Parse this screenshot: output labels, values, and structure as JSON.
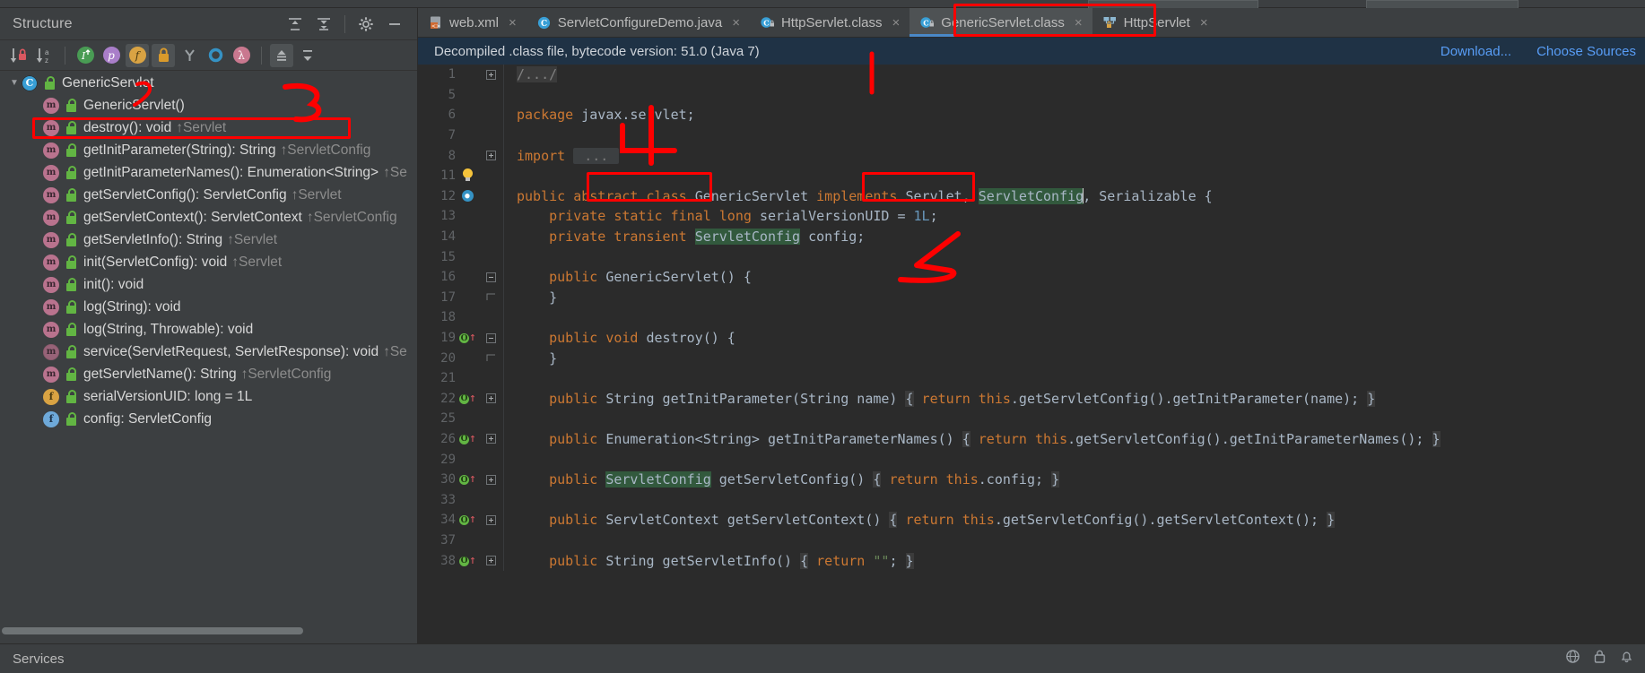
{
  "structure": {
    "title": "Structure",
    "header_actions": [
      {
        "name": "expand-all-icon",
        "glyph": "expand"
      },
      {
        "name": "collapse-all-icon",
        "glyph": "collapse"
      },
      {
        "name": "settings-gear-icon",
        "glyph": "gear"
      },
      {
        "name": "hide-icon",
        "glyph": "minus"
      }
    ],
    "toolbar": [
      {
        "name": "sort-by-visibility-button",
        "label": "sort-visibility"
      },
      {
        "name": "sort-alphabetically-button",
        "label": "sort-alpha"
      },
      {
        "name": "show-inherited-button",
        "label": "i"
      },
      {
        "name": "show-properties-button",
        "label": "p"
      },
      {
        "name": "show-fields-button",
        "label": "f"
      },
      {
        "name": "show-non-public-button",
        "label": "lock"
      },
      {
        "name": "show-anonymous-classes-button",
        "label": "Y"
      },
      {
        "name": "show-interfaces-button",
        "label": "O"
      },
      {
        "name": "show-lambdas-button",
        "label": "λ"
      },
      {
        "name": "scroll-from-source-button",
        "label": "up"
      },
      {
        "name": "scroll-to-source-button",
        "label": "down"
      }
    ],
    "tree": [
      {
        "icon": "class-icon",
        "visibility": "public",
        "label": "GenericServlet",
        "owner": "",
        "depth": 0,
        "expanded": true,
        "abstract": false,
        "kind": "class"
      },
      {
        "icon": "method-icon",
        "visibility": "public",
        "label": "GenericServlet()",
        "owner": "",
        "depth": 1,
        "abstract": false,
        "kind": "method"
      },
      {
        "icon": "method-icon",
        "visibility": "public",
        "label": "destroy(): void",
        "owner": "↑Servlet",
        "depth": 1,
        "abstract": false,
        "kind": "method"
      },
      {
        "icon": "method-icon",
        "visibility": "public",
        "label": "getInitParameter(String): String",
        "owner": "↑ServletConfig",
        "depth": 1,
        "abstract": false,
        "kind": "method",
        "highlighted": true
      },
      {
        "icon": "method-icon",
        "visibility": "public",
        "label": "getInitParameterNames(): Enumeration<String>",
        "owner": "↑Se",
        "depth": 1,
        "abstract": false,
        "kind": "method"
      },
      {
        "icon": "method-icon",
        "visibility": "public",
        "label": "getServletConfig(): ServletConfig",
        "owner": "↑Servlet",
        "depth": 1,
        "abstract": false,
        "kind": "method"
      },
      {
        "icon": "method-icon",
        "visibility": "public",
        "label": "getServletContext(): ServletContext",
        "owner": "↑ServletConfig",
        "depth": 1,
        "abstract": false,
        "kind": "method"
      },
      {
        "icon": "method-icon",
        "visibility": "public",
        "label": "getServletInfo(): String",
        "owner": "↑Servlet",
        "depth": 1,
        "abstract": false,
        "kind": "method"
      },
      {
        "icon": "method-icon",
        "visibility": "public",
        "label": "init(ServletConfig): void",
        "owner": "↑Servlet",
        "depth": 1,
        "abstract": false,
        "kind": "method"
      },
      {
        "icon": "method-icon",
        "visibility": "public",
        "label": "init(): void",
        "owner": "",
        "depth": 1,
        "abstract": false,
        "kind": "method"
      },
      {
        "icon": "method-icon",
        "visibility": "public",
        "label": "log(String): void",
        "owner": "",
        "depth": 1,
        "abstract": false,
        "kind": "method"
      },
      {
        "icon": "method-icon",
        "visibility": "public",
        "label": "log(String, Throwable): void",
        "owner": "",
        "depth": 1,
        "abstract": false,
        "kind": "method"
      },
      {
        "icon": "method-icon",
        "visibility": "public",
        "label": "service(ServletRequest, ServletResponse): void",
        "owner": "↑Se",
        "depth": 1,
        "abstract": true,
        "kind": "method"
      },
      {
        "icon": "method-icon",
        "visibility": "public",
        "label": "getServletName(): String",
        "owner": "↑ServletConfig",
        "depth": 1,
        "abstract": false,
        "kind": "method"
      },
      {
        "icon": "field-icon",
        "visibility": "private",
        "label": "serialVersionUID: long = 1L",
        "owner": "",
        "depth": 1,
        "abstract": false,
        "kind": "field"
      },
      {
        "icon": "field-icon-blue",
        "visibility": "private",
        "label": "config: ServletConfig",
        "owner": "",
        "depth": 1,
        "abstract": false,
        "kind": "field"
      }
    ]
  },
  "editor": {
    "tabs": [
      {
        "label": "web.xml",
        "icon": "xml-file-icon",
        "active": false,
        "closable": true
      },
      {
        "label": "ServletConfigureDemo.java",
        "icon": "java-class-icon",
        "active": false,
        "closable": true
      },
      {
        "label": "HttpServlet.class",
        "icon": "decompiled-class-icon",
        "active": false,
        "closable": true
      },
      {
        "label": "GenericServlet.class",
        "icon": "decompiled-class-icon",
        "active": true,
        "closable": true
      },
      {
        "label": "HttpServlet",
        "icon": "hierarchy-icon",
        "active": false,
        "closable": true
      }
    ],
    "notice": {
      "text": "Decompiled .class file, bytecode version: 51.0 (Java 7)",
      "links": [
        "Download...",
        "Choose Sources"
      ]
    },
    "lines": [
      {
        "num": "1",
        "fold": "+",
        "mark": "",
        "segments": [
          {
            "t": "/.../",
            "c": "cmt hl-brace"
          }
        ]
      },
      {
        "num": "5",
        "fold": "",
        "mark": "",
        "segments": []
      },
      {
        "num": "6",
        "fold": "",
        "mark": "",
        "segments": [
          {
            "t": "package ",
            "c": "kw"
          },
          {
            "t": "javax.servlet;",
            "c": "id"
          }
        ]
      },
      {
        "num": "7",
        "fold": "",
        "mark": "",
        "segments": []
      },
      {
        "num": "8",
        "fold": "+",
        "mark": "",
        "segments": [
          {
            "t": "import ",
            "c": "kw"
          },
          {
            "t": " ... ",
            "c": "dots"
          }
        ]
      },
      {
        "num": "11",
        "fold": "",
        "mark": "bulb",
        "segments": []
      },
      {
        "num": "12",
        "fold": "",
        "mark": "impl",
        "segments": [
          {
            "t": "public abstract class ",
            "c": "kw"
          },
          {
            "t": "GenericServlet ",
            "c": "id"
          },
          {
            "t": "implements ",
            "c": "kw"
          },
          {
            "t": "Servlet, ",
            "c": "id"
          },
          {
            "t": "ServletConfig",
            "c": "id hl"
          },
          {
            "t": ", Serializable {",
            "c": "id"
          }
        ]
      },
      {
        "num": "13",
        "fold": "",
        "mark": "",
        "segments": [
          {
            "t": "    private static final ",
            "c": "kw"
          },
          {
            "t": "long ",
            "c": "kw"
          },
          {
            "t": "serialVersionUID = ",
            "c": "id"
          },
          {
            "t": "1L",
            "c": "num"
          },
          {
            "t": ";",
            "c": "id"
          }
        ]
      },
      {
        "num": "14",
        "fold": "",
        "mark": "",
        "segments": [
          {
            "t": "    private transient ",
            "c": "kw"
          },
          {
            "t": "ServletConfig",
            "c": "id hl"
          },
          {
            "t": " config;",
            "c": "id"
          }
        ]
      },
      {
        "num": "15",
        "fold": "",
        "mark": "",
        "segments": []
      },
      {
        "num": "16",
        "fold": "-",
        "mark": "",
        "segments": [
          {
            "t": "    public ",
            "c": "kw"
          },
          {
            "t": "GenericServlet() {",
            "c": "id"
          }
        ]
      },
      {
        "num": "17",
        "fold": "^",
        "mark": "",
        "segments": [
          {
            "t": "    }",
            "c": "id"
          }
        ]
      },
      {
        "num": "18",
        "fold": "",
        "mark": "",
        "segments": []
      },
      {
        "num": "19",
        "fold": "-",
        "mark": "override",
        "segments": [
          {
            "t": "    public void ",
            "c": "kw"
          },
          {
            "t": "destroy() {",
            "c": "id"
          }
        ]
      },
      {
        "num": "20",
        "fold": "^",
        "mark": "",
        "segments": [
          {
            "t": "    }",
            "c": "id"
          }
        ]
      },
      {
        "num": "21",
        "fold": "",
        "mark": "",
        "segments": []
      },
      {
        "num": "22",
        "fold": "+",
        "mark": "override",
        "segments": [
          {
            "t": "    public ",
            "c": "kw"
          },
          {
            "t": "String getInitParameter(String name) ",
            "c": "id"
          },
          {
            "t": "{",
            "c": "hl-brace"
          },
          {
            "t": " ",
            "c": "id"
          },
          {
            "t": "return ",
            "c": "kw"
          },
          {
            "t": "this",
            "c": "kw"
          },
          {
            "t": ".getServletConfig().getInitParameter(name); ",
            "c": "id"
          },
          {
            "t": "}",
            "c": "hl-brace"
          }
        ]
      },
      {
        "num": "25",
        "fold": "",
        "mark": "",
        "segments": []
      },
      {
        "num": "26",
        "fold": "+",
        "mark": "override",
        "segments": [
          {
            "t": "    public ",
            "c": "kw"
          },
          {
            "t": "Enumeration<String> getInitParameterNames() ",
            "c": "id"
          },
          {
            "t": "{",
            "c": "hl-brace"
          },
          {
            "t": " ",
            "c": "id"
          },
          {
            "t": "return ",
            "c": "kw"
          },
          {
            "t": "this",
            "c": "kw"
          },
          {
            "t": ".getServletConfig().getInitParameterNames(); ",
            "c": "id"
          },
          {
            "t": "}",
            "c": "hl-brace"
          }
        ]
      },
      {
        "num": "29",
        "fold": "",
        "mark": "",
        "segments": []
      },
      {
        "num": "30",
        "fold": "+",
        "mark": "override",
        "segments": [
          {
            "t": "    public ",
            "c": "kw"
          },
          {
            "t": "ServletConfig",
            "c": "id hl"
          },
          {
            "t": " getServletConfig() ",
            "c": "id"
          },
          {
            "t": "{",
            "c": "hl-brace"
          },
          {
            "t": " ",
            "c": "id"
          },
          {
            "t": "return ",
            "c": "kw"
          },
          {
            "t": "this",
            "c": "kw"
          },
          {
            "t": ".config; ",
            "c": "id"
          },
          {
            "t": "}",
            "c": "hl-brace"
          }
        ]
      },
      {
        "num": "33",
        "fold": "",
        "mark": "",
        "segments": []
      },
      {
        "num": "34",
        "fold": "+",
        "mark": "override",
        "segments": [
          {
            "t": "    public ",
            "c": "kw"
          },
          {
            "t": "ServletContext getServletContext() ",
            "c": "id"
          },
          {
            "t": "{",
            "c": "hl-brace"
          },
          {
            "t": " ",
            "c": "id"
          },
          {
            "t": "return ",
            "c": "kw"
          },
          {
            "t": "this",
            "c": "kw"
          },
          {
            "t": ".getServletConfig().getServletContext(); ",
            "c": "id"
          },
          {
            "t": "}",
            "c": "hl-brace"
          }
        ]
      },
      {
        "num": "37",
        "fold": "",
        "mark": "",
        "segments": []
      },
      {
        "num": "38",
        "fold": "+",
        "mark": "override",
        "segments": [
          {
            "t": "    public ",
            "c": "kw"
          },
          {
            "t": "String getServletInfo() ",
            "c": "id"
          },
          {
            "t": "{",
            "c": "hl-brace"
          },
          {
            "t": " ",
            "c": "id"
          },
          {
            "t": "return ",
            "c": "kw"
          },
          {
            "t": "\"\"",
            "c": "str"
          },
          {
            "t": "; ",
            "c": "id"
          },
          {
            "t": "}",
            "c": "hl-brace"
          }
        ]
      }
    ]
  },
  "statusbar": {
    "services_label": "Services",
    "right_icons": [
      {
        "name": "globe-icon"
      },
      {
        "name": "lock-icon"
      },
      {
        "name": "notifications-icon"
      }
    ]
  },
  "annotations": {
    "color": "#fe0000",
    "numbers": [
      "3",
      "4",
      "5"
    ]
  }
}
